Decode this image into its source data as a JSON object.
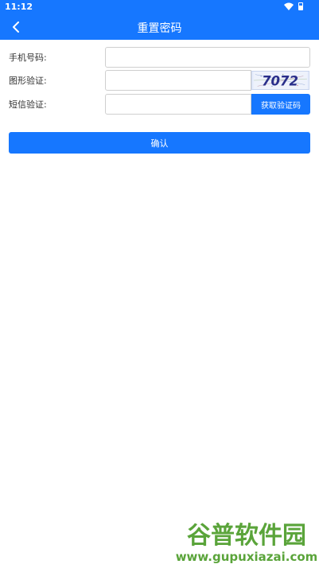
{
  "status_bar": {
    "time": "11:12",
    "icons": [
      "wifi-icon",
      "battery-icon"
    ]
  },
  "header": {
    "title": "重置密码",
    "back_icon": "chevron-left-icon"
  },
  "form": {
    "phone": {
      "label": "手机号码:",
      "value": "",
      "placeholder": ""
    },
    "image_captcha": {
      "label": "图形验证:",
      "value": "",
      "placeholder": "",
      "captcha_text": "7072"
    },
    "sms_code": {
      "label": "短信验证:",
      "value": "",
      "placeholder": "",
      "button_label": "获取验证码"
    }
  },
  "confirm_label": "确认",
  "watermark": {
    "logo_text": "谷普软件园",
    "url_text": "www.gupuxiazai.com"
  },
  "colors": {
    "primary": "#1677ff",
    "background": "#ffffff",
    "watermark_green": "#5aa43a"
  }
}
